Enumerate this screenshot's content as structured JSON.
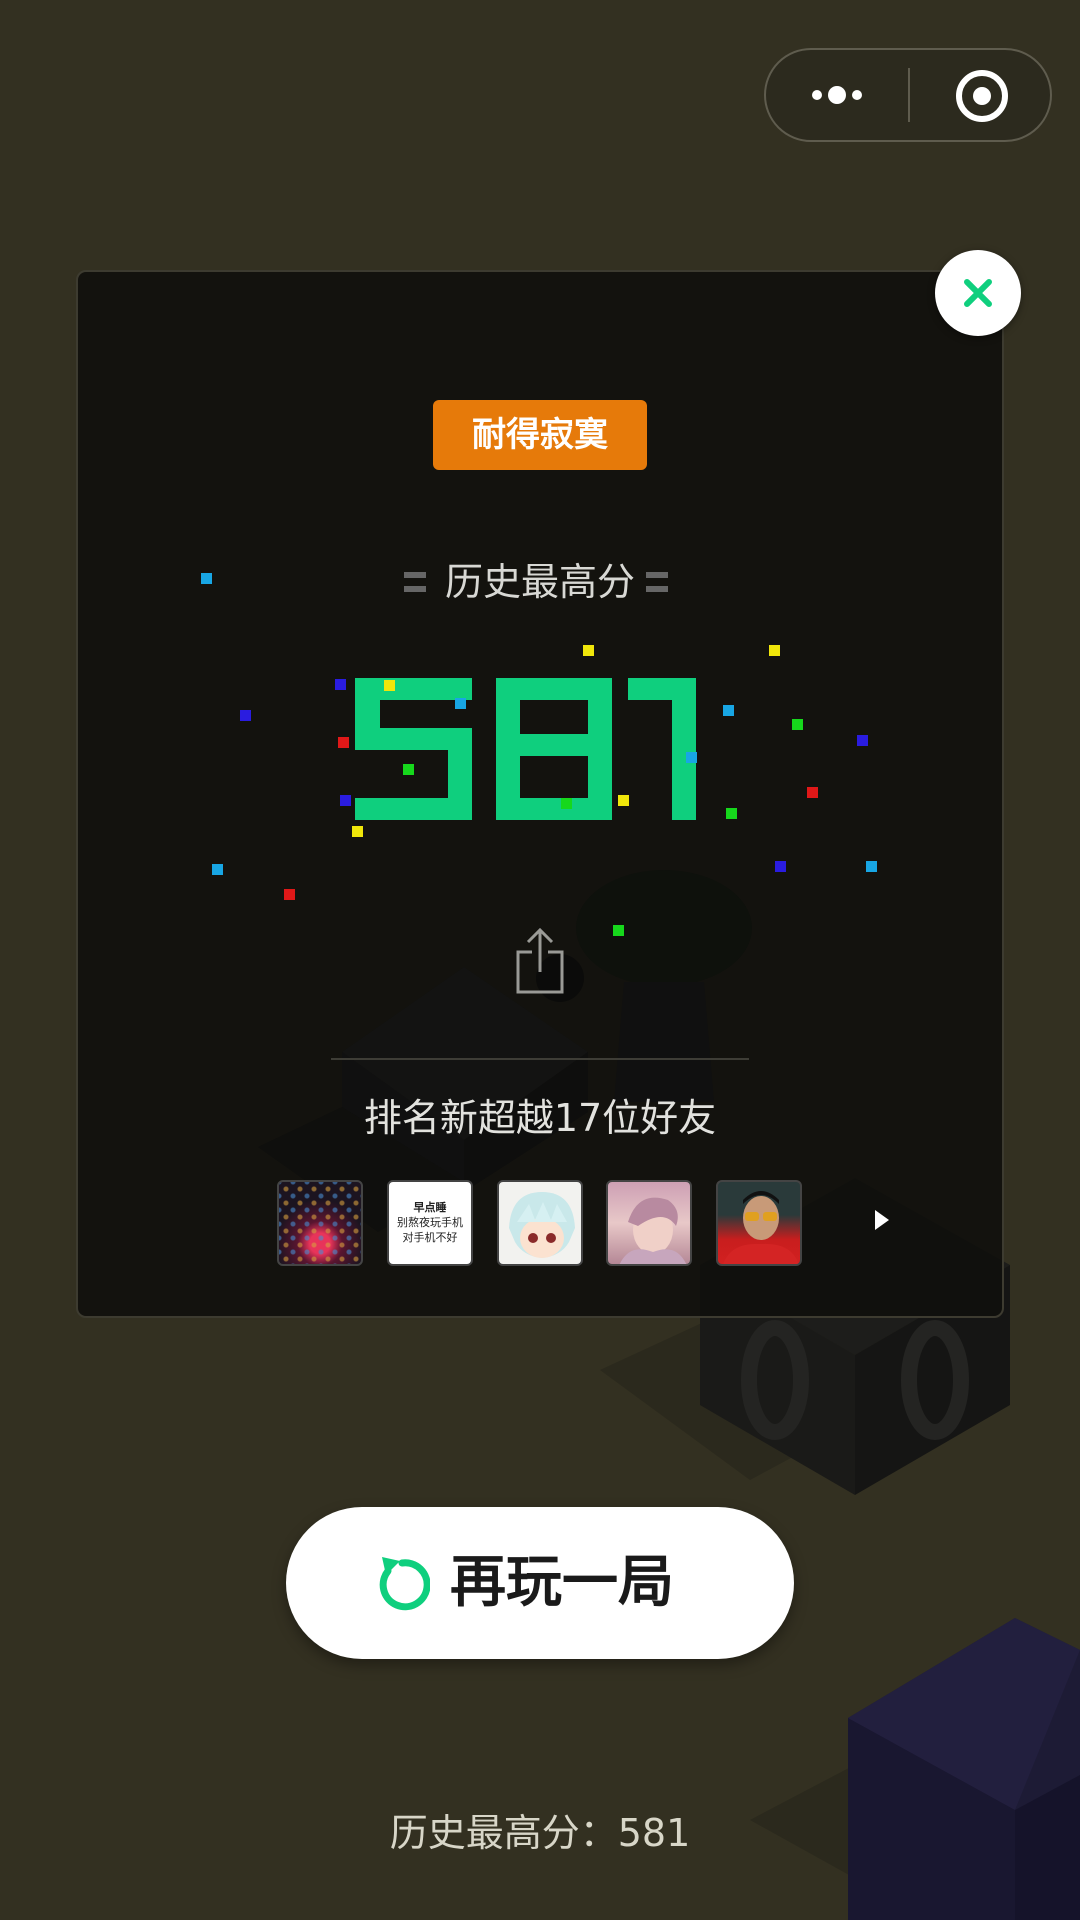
{
  "capsule": {
    "menu_icon": "more-dots-icon",
    "exit_icon": "target-icon"
  },
  "dialog": {
    "close_icon": "close-icon",
    "badge": "耐得寂寞",
    "best_label": "历史最高分",
    "score": "581",
    "share_icon": "share-icon",
    "rank_text": "排名新超越17位好友",
    "friends": [
      {
        "name": "friend-avatar-1"
      },
      {
        "name": "friend-avatar-2",
        "text_lines": [
          "早点睡",
          "别熬夜玩手机",
          "对手机不好"
        ]
      },
      {
        "name": "friend-avatar-3"
      },
      {
        "name": "friend-avatar-4"
      },
      {
        "name": "friend-avatar-5"
      }
    ],
    "more_icon": "play-arrow-icon"
  },
  "replay": {
    "icon": "replay-icon",
    "label": "再玩一局"
  },
  "footer": {
    "best_score_text": "历史最高分：581"
  },
  "colors": {
    "accent_green": "#0fcf7e",
    "badge_orange": "#e67a0a",
    "background": "#333021"
  }
}
